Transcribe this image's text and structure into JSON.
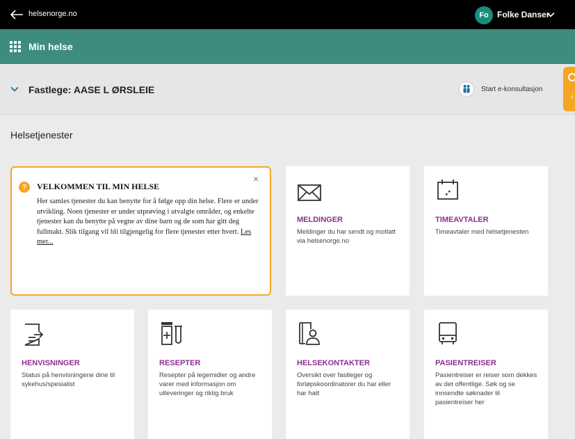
{
  "topbar": {
    "site": "helsenorge.no",
    "avatar_initials": "Fo",
    "user_name": "Folke Danser"
  },
  "appbar": {
    "title": "Min helse"
  },
  "gpbar": {
    "gp_label": "Fastlege: AASE L ØRSLEIE",
    "ekonsultasjon_label": "Start e-konsultasjon"
  },
  "section_title": "Helsetjenester",
  "welcome": {
    "icon_text": "?",
    "title": "VELKOMMEN TIL MIN HELSE",
    "close": "×",
    "text": "Her samles tjenester du kan benytte for å følge opp din helse. Flere er under utvikling. Noen tjenester er under utprøving i utvalgte områder, og enkelte tjenester kan du benytte på vegne av dine barn og de som har gitt deg fullmakt. Slik tilgang vil bli tilgjengelig for flere tjenester etter hvert.",
    "more": "Les mer..."
  },
  "cards": {
    "meldinger": {
      "title": "MELDINGER",
      "desc": "Meldinger du har sendt og mottatt via helsenorge.no"
    },
    "timeavtaler": {
      "title": "TIMEAVTALER",
      "desc": "Timeavtaler med helsetjenesten"
    },
    "henvisninger": {
      "title": "HENVISNINGER",
      "desc": "Status på henvisningene dine til sykehus/spesialist"
    },
    "resepter": {
      "title": "RESEPTER",
      "desc": "Resepter på legemidler og andre varer med informasjon om utleveringer og riktig bruk"
    },
    "helsekontakter": {
      "title": "HELSEKONTAKTER",
      "desc": "Oversikt over fastleger og forløpskoordinatorer du har eller har hatt"
    },
    "pasientreiser": {
      "title": "PASIENTREISER",
      "desc": "Pasientreiser er reiser som dekkes av det offentlige. Søk og se innsendte søknader til pasientreiser her"
    }
  },
  "colors": {
    "topbar": "#000000",
    "appbar": "#3d8c7f",
    "accent_orange": "#f5a623",
    "card_title": "#8b2f8f",
    "avatar": "#1b8b7c"
  }
}
